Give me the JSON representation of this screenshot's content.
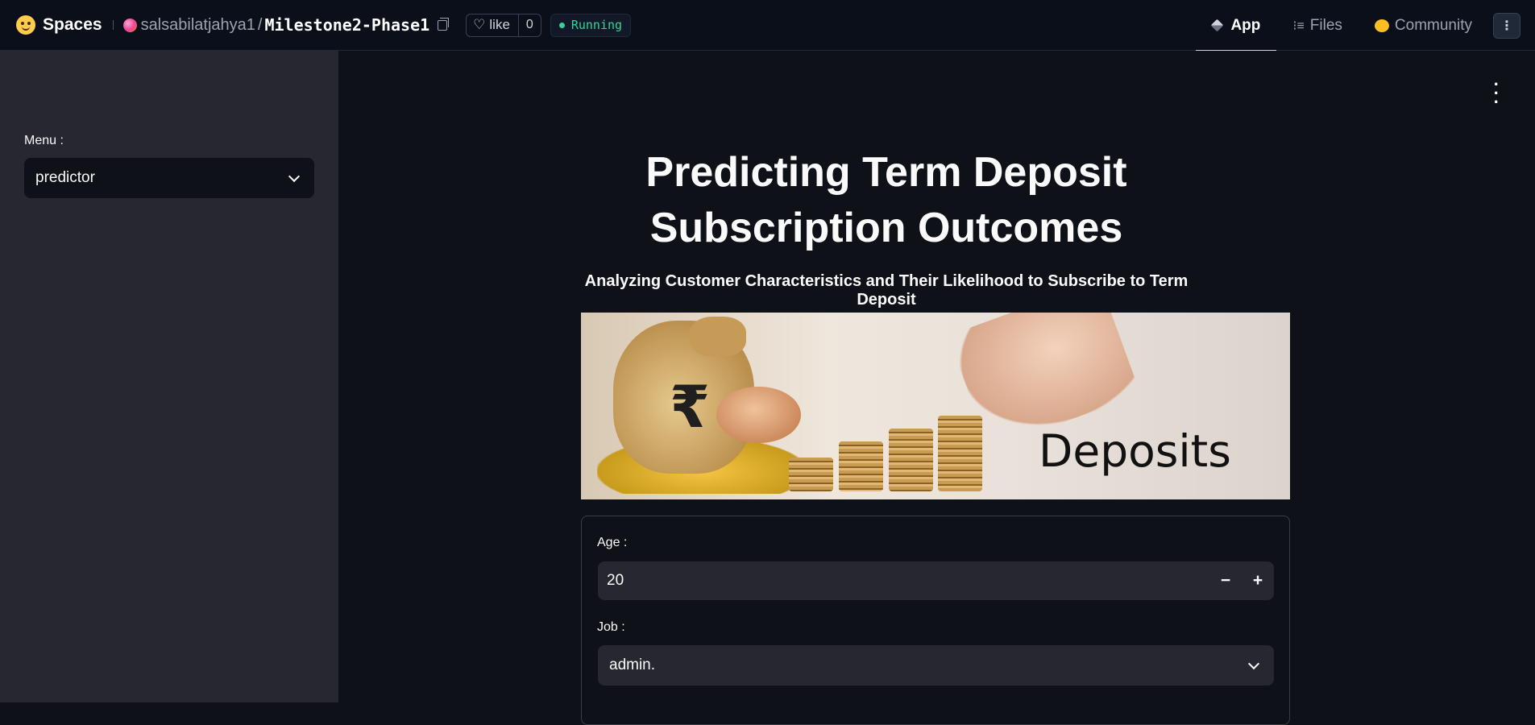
{
  "topbar": {
    "brand": "Spaces",
    "owner": "salsabilatjahya1",
    "separator": "/",
    "repo": "Milestone2-Phase1",
    "like_label": "like",
    "like_count": "0",
    "status": "Running",
    "status_color": "#34d399"
  },
  "nav": {
    "tabs": [
      {
        "label": "App",
        "icon": "cube-icon",
        "active": true
      },
      {
        "label": "Files",
        "icon": "files-icon",
        "active": false
      },
      {
        "label": "Community",
        "icon": "community-icon",
        "active": false
      }
    ]
  },
  "sidebar": {
    "menu_label": "Menu :",
    "menu_value": "predictor"
  },
  "main": {
    "title_line1": "Predicting Term Deposit",
    "title_line2": "Subscription Outcomes",
    "subtitle": "Analyzing Customer Characteristics and Their Likelihood to Subscribe to Term Deposit",
    "banner": {
      "text": "Deposits",
      "symbol": "₹"
    },
    "form": {
      "age_label": "Age :",
      "age_value": "20",
      "minus": "−",
      "plus": "+",
      "job_label": "Job :",
      "job_value": "admin."
    }
  }
}
